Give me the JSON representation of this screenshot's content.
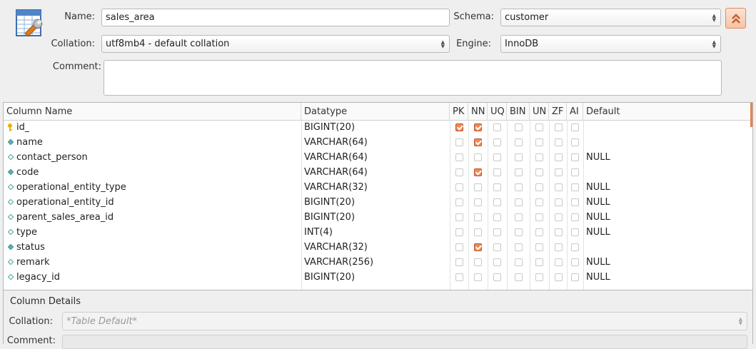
{
  "form": {
    "name_label": "Name:",
    "name_value": "sales_area",
    "schema_label": "Schema:",
    "schema_value": "customer",
    "collation_label": "Collation:",
    "collation_value": "utf8mb4 - default collation",
    "engine_label": "Engine:",
    "engine_value": "InnoDB",
    "comment_label": "Comment:",
    "comment_value": ""
  },
  "grid": {
    "headers": [
      "Column Name",
      "Datatype",
      "PK",
      "NN",
      "UQ",
      "BIN",
      "UN",
      "ZF",
      "AI",
      "Default"
    ],
    "rows": [
      {
        "name": "id_",
        "type": "BIGINT(20)",
        "icon": "key",
        "flags": [
          true,
          true,
          false,
          false,
          false,
          false,
          false
        ],
        "default": ""
      },
      {
        "name": "name",
        "type": "VARCHAR(64)",
        "icon": "filled",
        "flags": [
          false,
          true,
          false,
          false,
          false,
          false,
          false
        ],
        "default": ""
      },
      {
        "name": "contact_person",
        "type": "VARCHAR(64)",
        "icon": "open",
        "flags": [
          false,
          false,
          false,
          false,
          false,
          false,
          false
        ],
        "default": "NULL"
      },
      {
        "name": "code",
        "type": "VARCHAR(64)",
        "icon": "filled",
        "flags": [
          false,
          true,
          false,
          false,
          false,
          false,
          false
        ],
        "default": ""
      },
      {
        "name": "operational_entity_type",
        "type": "VARCHAR(32)",
        "icon": "open",
        "flags": [
          false,
          false,
          false,
          false,
          false,
          false,
          false
        ],
        "default": "NULL"
      },
      {
        "name": "operational_entity_id",
        "type": "BIGINT(20)",
        "icon": "open",
        "flags": [
          false,
          false,
          false,
          false,
          false,
          false,
          false
        ],
        "default": "NULL"
      },
      {
        "name": "parent_sales_area_id",
        "type": "BIGINT(20)",
        "icon": "open",
        "flags": [
          false,
          false,
          false,
          false,
          false,
          false,
          false
        ],
        "default": "NULL"
      },
      {
        "name": "type",
        "type": "INT(4)",
        "icon": "open",
        "flags": [
          false,
          false,
          false,
          false,
          false,
          false,
          false
        ],
        "default": "NULL"
      },
      {
        "name": "status",
        "type": "VARCHAR(32)",
        "icon": "filled",
        "flags": [
          false,
          true,
          false,
          false,
          false,
          false,
          false
        ],
        "default": ""
      },
      {
        "name": "remark",
        "type": "VARCHAR(256)",
        "icon": "open",
        "flags": [
          false,
          false,
          false,
          false,
          false,
          false,
          false
        ],
        "default": "NULL"
      },
      {
        "name": "legacy_id",
        "type": "BIGINT(20)",
        "icon": "open",
        "flags": [
          false,
          false,
          false,
          false,
          false,
          false,
          false
        ],
        "default": "NULL"
      }
    ]
  },
  "details": {
    "title": "Column Details",
    "collation_label": "Collation:",
    "collation_placeholder": "*Table Default*",
    "comment_label": "Comment:"
  },
  "colors": {
    "accent": "#f08a55",
    "accent_border": "#b8562c",
    "column_icon": "#5fb3b3",
    "key_icon": "#e8b300"
  }
}
